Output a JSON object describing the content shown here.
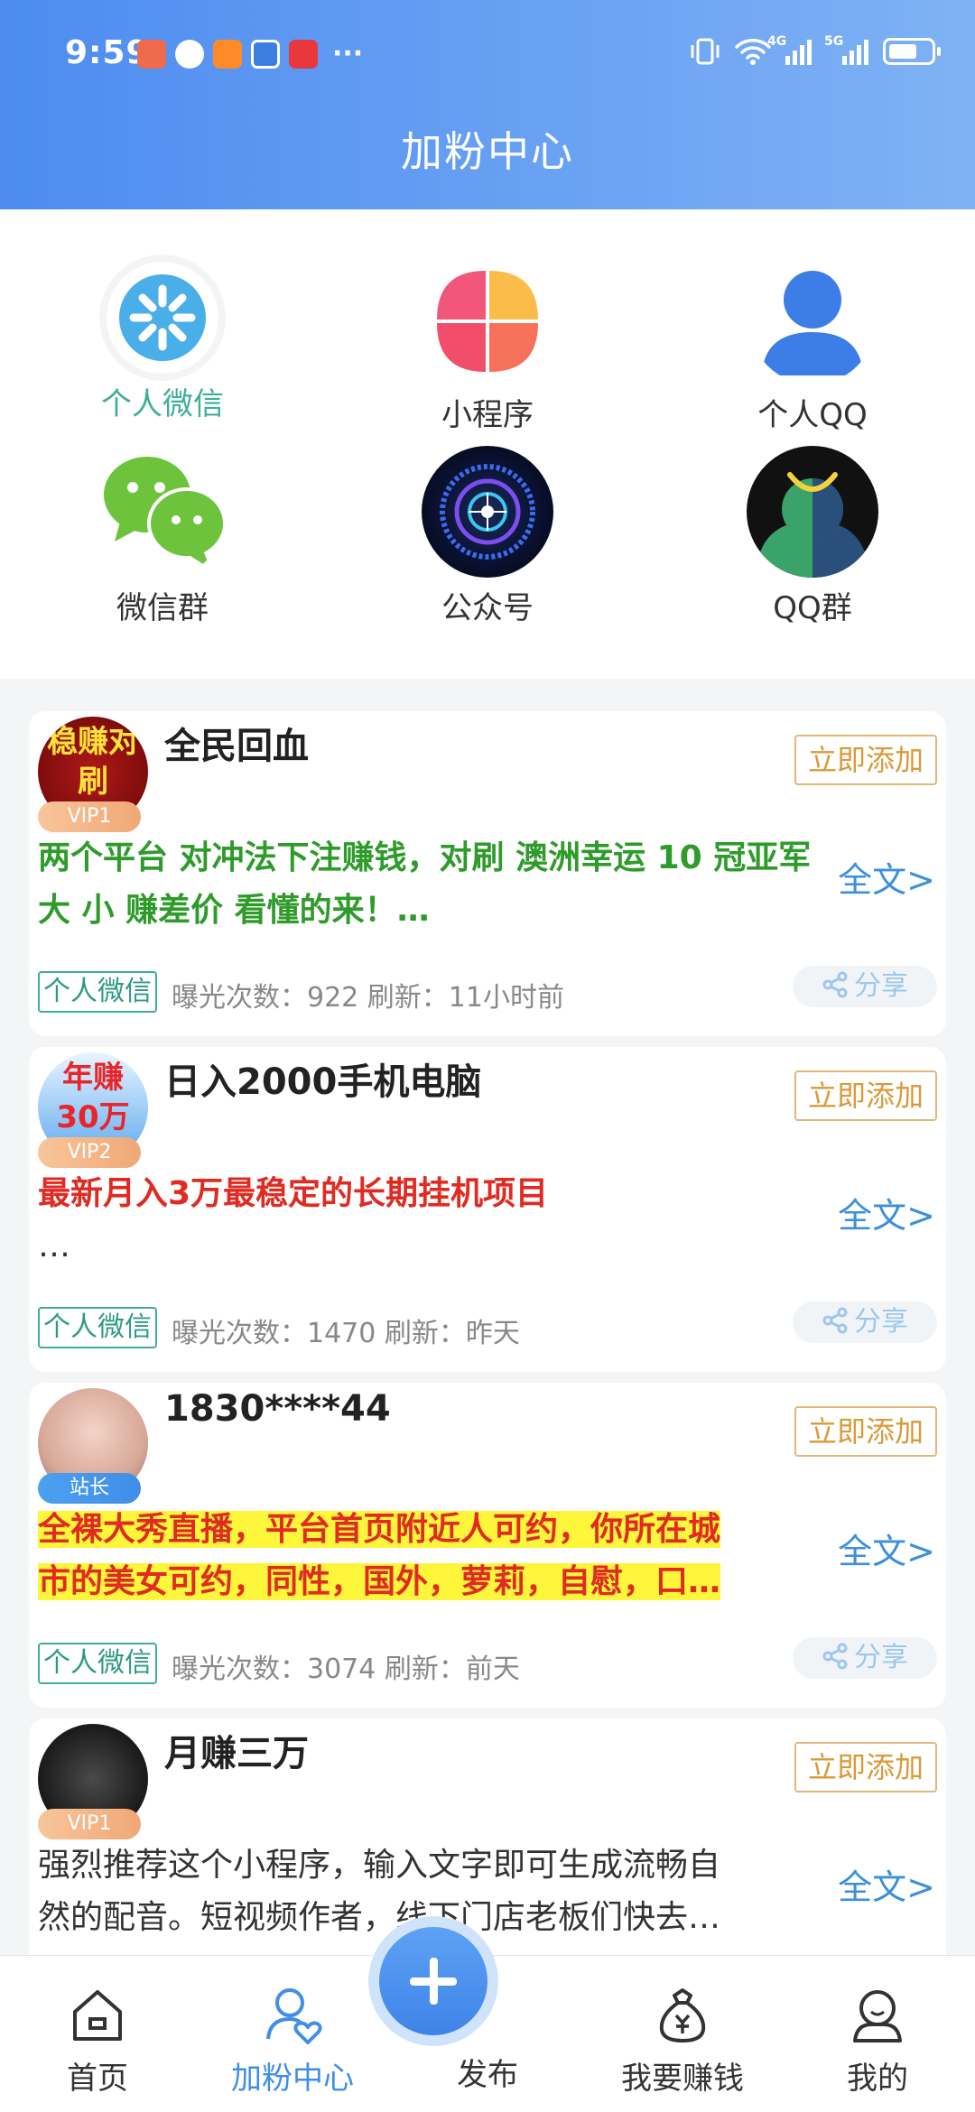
{
  "status_bar": {
    "time": "9:59",
    "more": "···",
    "signal_1": "4G",
    "signal_2": "5G"
  },
  "header": {
    "title": "加粉中心"
  },
  "categories": [
    {
      "label": "个人微信",
      "icon": "wechat-personal-icon",
      "active": true
    },
    {
      "label": "小程序",
      "icon": "mini-program-icon"
    },
    {
      "label": "个人QQ",
      "icon": "qq-personal-icon"
    },
    {
      "label": "微信群",
      "icon": "wechat-group-icon"
    },
    {
      "label": "公众号",
      "icon": "official-account-icon"
    },
    {
      "label": "QQ群",
      "icon": "qq-group-icon"
    }
  ],
  "cards": [
    {
      "name": "全民回血",
      "badge": "VIP1",
      "avatar_text": "稳赚对刷",
      "desc": "两个平台 对冲法下注赚钱，对刷 澳洲幸运 10 冠亚军 大 小 赚差价 看懂的来！…",
      "tag": "个人微信",
      "meta": "曝光次数：922  刷新：11小时前"
    },
    {
      "name": "日入2000手机电脑",
      "badge": "VIP2",
      "avatar_text": "年赚30万",
      "desc": "最新月入3万最稳定的长期挂机项目",
      "desc2": "…",
      "tag": "个人微信",
      "meta": "曝光次数：1470  刷新：昨天"
    },
    {
      "name": "1830****44",
      "badge": "站长",
      "desc": "全裸大秀直播，平台首页附近人可约，你所在城",
      "desc2": "市的美女可约，同性，国外，萝莉，自慰，口…",
      "tag": "个人微信",
      "meta": "曝光次数：3074  刷新：前天"
    },
    {
      "name": "月赚三万",
      "badge": "VIP1",
      "desc": "强烈推荐这个小程序，输入文字即可生成流畅自",
      "desc2": "然的配音。短视频作者，线下门店老板们快去…"
    }
  ],
  "common": {
    "add_label": "立即添加",
    "fulltext_label": "全文>",
    "share_label": "分享"
  },
  "nav": [
    {
      "label": "首页",
      "icon": "home-icon"
    },
    {
      "label": "加粉中心",
      "icon": "fans-center-icon",
      "active": true
    },
    {
      "label": "发布",
      "icon": "publish-plus-icon"
    },
    {
      "label": "我要赚钱",
      "icon": "money-bag-icon"
    },
    {
      "label": "我的",
      "icon": "profile-icon"
    }
  ],
  "colors": {
    "header_start": "#4d8cf0",
    "header_end": "#7fb2f5",
    "accent": "#3f8ee8",
    "tag_green": "#3fae9a",
    "add_orange": "#d99a3a"
  }
}
